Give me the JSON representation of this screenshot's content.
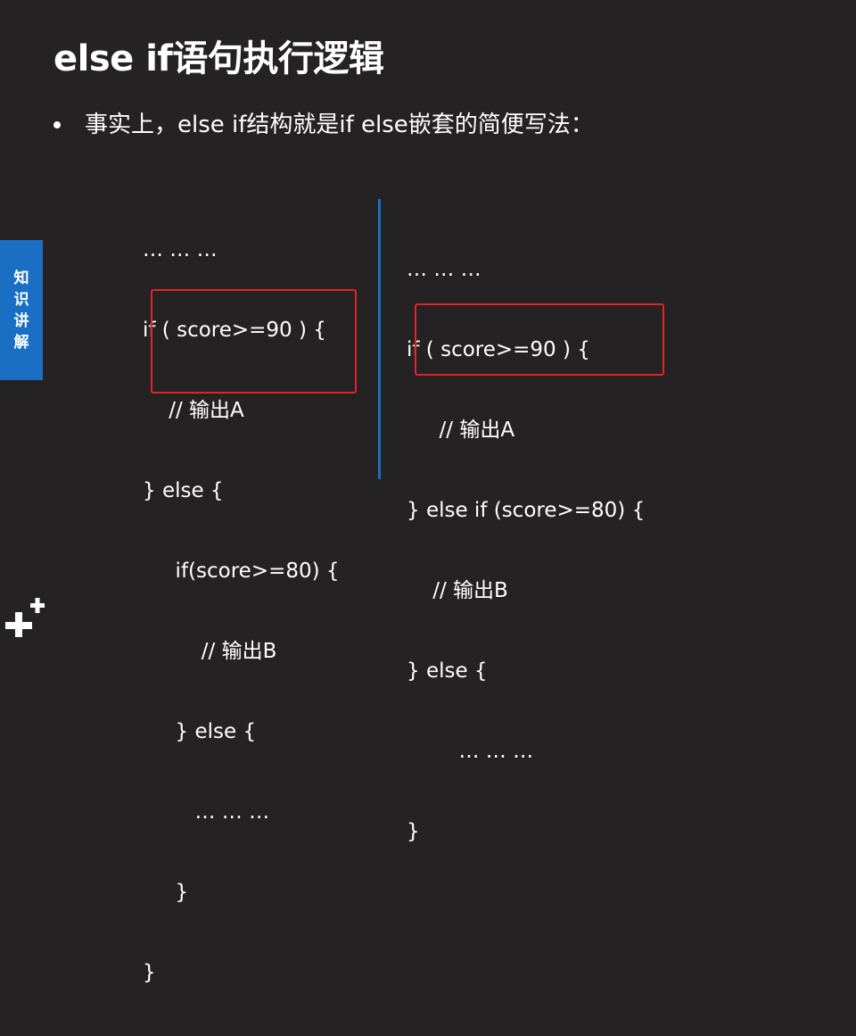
{
  "slide": {
    "title": "else if语句执行逻辑",
    "bullet_text": "事实上，else if结构就是if else嵌套的简便写法：",
    "side_tab_chars": [
      "知",
      "识",
      "讲",
      "解"
    ]
  },
  "code_left": {
    "lines": [
      "… … …",
      "if ( score>=90 ) {",
      "    // 输出A",
      "} else {",
      "     if(score>=80) {",
      "         // 输出B",
      "     } else {",
      "        … … …",
      "     }",
      "}"
    ]
  },
  "code_right": {
    "lines": [
      "… … …",
      "if ( score>=90 ) {",
      "     // 输出A",
      "} else if (score>=80) {",
      "    // 输出B",
      "} else {",
      "        … … …",
      "}"
    ]
  },
  "colors": {
    "background": "#252223",
    "accent_blue": "#1a6fc4",
    "highlight_red": "#e02428",
    "text": "#ffffff"
  },
  "icons": {
    "logo": "plus-plus-logo-icon",
    "bullet": "bullet-dot-icon"
  }
}
